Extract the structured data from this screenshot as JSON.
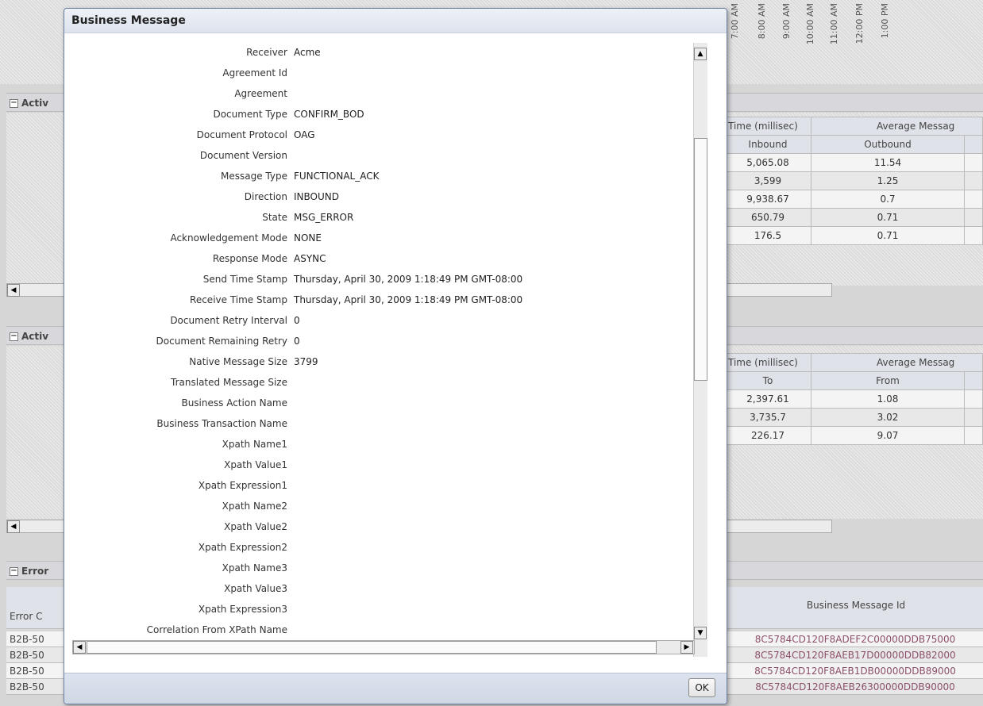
{
  "background": {
    "time_ticks": [
      "7:00 AM",
      "8:00 AM",
      "9:00 AM",
      "10:00 AM",
      "11:00 AM",
      "12:00 PM",
      "1:00 PM"
    ],
    "section1": {
      "title": "Activ",
      "header_group1": "Time (millisec)",
      "header_group2": "Average Messag",
      "sub1": "Inbound",
      "sub2": "Outbound",
      "rows": [
        [
          "5,065.08",
          "11.54"
        ],
        [
          "3,599",
          "1.25"
        ],
        [
          "9,938.67",
          "0.7"
        ],
        [
          "650.79",
          "0.71"
        ],
        [
          "176.5",
          "0.71"
        ]
      ]
    },
    "section2": {
      "title": "Activ",
      "header_group1": "Time (millisec)",
      "header_group2": "Average Messag",
      "sub1": "To",
      "sub2": "From",
      "rows": [
        [
          "2,397.61",
          "1.08"
        ],
        [
          "3,735.7",
          "3.02"
        ],
        [
          "226.17",
          "9.07"
        ]
      ]
    },
    "section3": {
      "title": "Error",
      "col1": "Error C",
      "col2": "Business Message Id",
      "rows": [
        [
          "B2B-50",
          "8C5784CD120F8ADEF2C00000DDB75000"
        ],
        [
          "B2B-50",
          "8C5784CD120F8AEB17D00000DDB82000"
        ],
        [
          "B2B-50",
          "8C5784CD120F8AEB1DB00000DDB89000"
        ],
        [
          "B2B-50",
          "8C5784CD120F8AEB26300000DDB90000"
        ]
      ]
    }
  },
  "dialog": {
    "title": "Business Message",
    "ok_label": "OK",
    "fields": [
      {
        "key": "Receiver",
        "value": "Acme"
      },
      {
        "key": "Agreement Id",
        "value": ""
      },
      {
        "key": "Agreement",
        "value": ""
      },
      {
        "key": "Document Type",
        "value": "CONFIRM_BOD"
      },
      {
        "key": "Document Protocol",
        "value": "OAG"
      },
      {
        "key": "Document Version",
        "value": ""
      },
      {
        "key": "Message Type",
        "value": "FUNCTIONAL_ACK"
      },
      {
        "key": "Direction",
        "value": "INBOUND"
      },
      {
        "key": "State",
        "value": "MSG_ERROR"
      },
      {
        "key": "Acknowledgement Mode",
        "value": "NONE"
      },
      {
        "key": "Response Mode",
        "value": "ASYNC"
      },
      {
        "key": "Send Time Stamp",
        "value": "Thursday, April 30, 2009 1:18:49 PM GMT-08:00"
      },
      {
        "key": "Receive Time Stamp",
        "value": "Thursday, April 30, 2009 1:18:49 PM GMT-08:00"
      },
      {
        "key": "Document Retry Interval",
        "value": "0"
      },
      {
        "key": "Document Remaining Retry",
        "value": "0"
      },
      {
        "key": "Native Message Size",
        "value": "3799"
      },
      {
        "key": "Translated Message Size",
        "value": ""
      },
      {
        "key": "Business Action Name",
        "value": ""
      },
      {
        "key": "Business Transaction Name",
        "value": ""
      },
      {
        "key": "Xpath Name1",
        "value": ""
      },
      {
        "key": "Xpath Value1",
        "value": ""
      },
      {
        "key": "Xpath Expression1",
        "value": ""
      },
      {
        "key": "Xpath Name2",
        "value": ""
      },
      {
        "key": "Xpath Value2",
        "value": ""
      },
      {
        "key": "Xpath Expression2",
        "value": ""
      },
      {
        "key": "Xpath Name3",
        "value": ""
      },
      {
        "key": "Xpath Value3",
        "value": ""
      },
      {
        "key": "Xpath Expression3",
        "value": ""
      },
      {
        "key": "Correlation From XPath Name",
        "value": ""
      }
    ]
  }
}
